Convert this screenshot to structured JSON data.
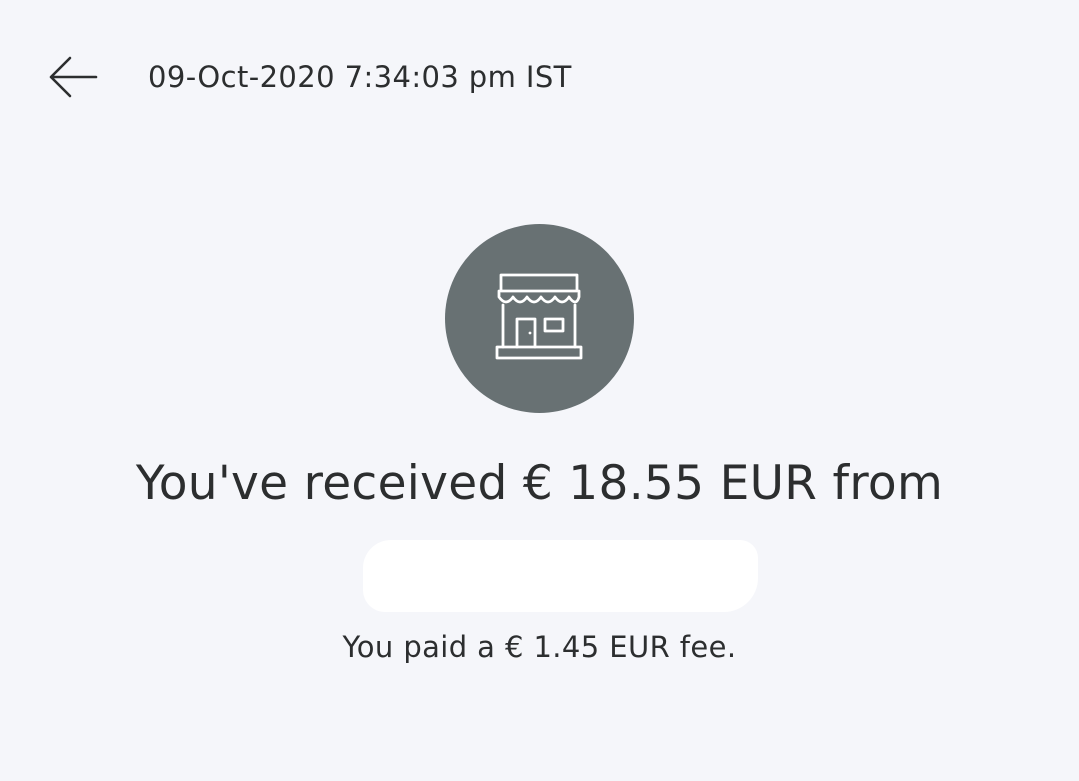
{
  "header": {
    "back_icon": "arrow-left-icon",
    "timestamp": "09-Oct-2020 7:34:03 pm IST"
  },
  "transaction": {
    "avatar_icon": "storefront-icon",
    "avatar_color": "#687173",
    "headline": "You've received € 18.55 EUR from",
    "sender_name": "",
    "fee_text": "You paid a € 1.45 EUR fee."
  },
  "colors": {
    "background": "#f5f6fa",
    "text": "#2c2e2f",
    "icon_stroke": "#ffffff"
  }
}
